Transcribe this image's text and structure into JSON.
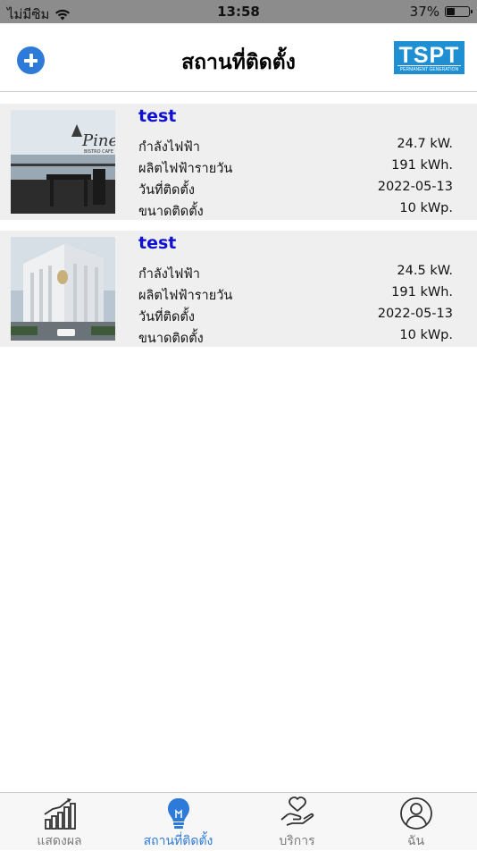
{
  "status_bar": {
    "carrier": "ไม่มีซิม",
    "time": "13:58",
    "battery_percent": "37%",
    "battery_level": 0.37
  },
  "nav": {
    "title": "สถานที่ติดตั้ง",
    "add_icon": "plus-circle-icon",
    "logo_text": "TSPT",
    "logo_subtext": "PERMANENT GENERATION",
    "accent_color": "#2e7ad8",
    "logo_color": "#1f8fd4"
  },
  "sites": [
    {
      "name": "test",
      "thumbnail": "cafe-terrace-photo",
      "rows": [
        {
          "label": "กำลังไฟฟ้า",
          "value": "24.7 kW."
        },
        {
          "label": "ผลิตไฟฟ้ารายวัน",
          "value": "191 kWh."
        },
        {
          "label": "วันที่ติดตั้ง",
          "value": "2022-05-13"
        },
        {
          "label": "ขนาดติดตั้ง",
          "value": "10 kWp."
        }
      ]
    },
    {
      "name": "test",
      "thumbnail": "white-building-photo",
      "rows": [
        {
          "label": "กำลังไฟฟ้า",
          "value": "24.5 kW."
        },
        {
          "label": "ผลิตไฟฟ้ารายวัน",
          "value": "191 kWh."
        },
        {
          "label": "วันที่ติดตั้ง",
          "value": "2022-05-13"
        },
        {
          "label": "ขนาดติดตั้ง",
          "value": "10 kWp."
        }
      ]
    }
  ],
  "tabs": [
    {
      "label": "แสดงผล",
      "icon": "bar-chart-icon",
      "active": false
    },
    {
      "label": "สถานที่ติดตั้ง",
      "icon": "lightbulb-icon",
      "active": true
    },
    {
      "label": "บริการ",
      "icon": "heart-hand-icon",
      "active": false
    },
    {
      "label": "ฉัน",
      "icon": "user-icon",
      "active": false
    }
  ],
  "name_color": "#1010d0"
}
